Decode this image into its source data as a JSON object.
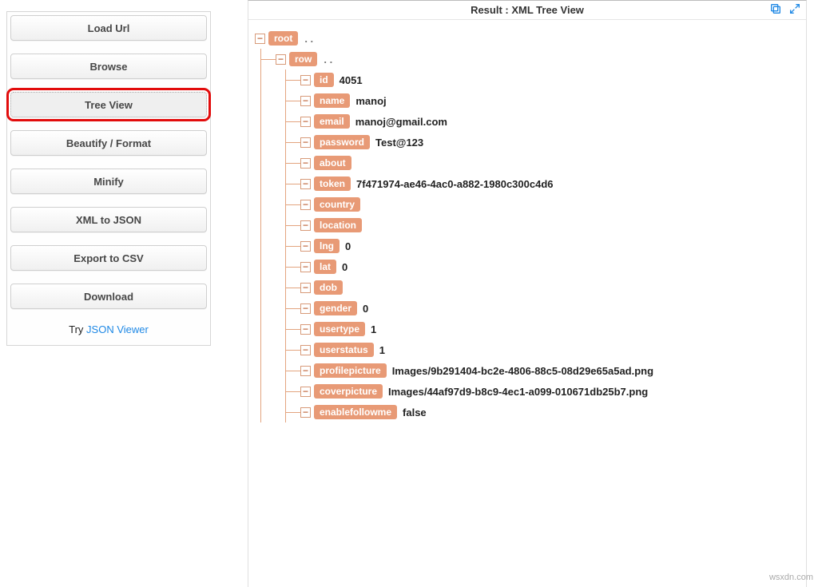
{
  "sidebar": {
    "buttons": [
      {
        "label": "Load Url",
        "selected": false
      },
      {
        "label": "Browse",
        "selected": false
      },
      {
        "label": "Tree View",
        "selected": true
      },
      {
        "label": "Beautify / Format",
        "selected": false
      },
      {
        "label": "Minify",
        "selected": false
      },
      {
        "label": "XML to JSON",
        "selected": false
      },
      {
        "label": "Export to CSV",
        "selected": false
      },
      {
        "label": "Download",
        "selected": false
      }
    ],
    "try_prefix": "Try ",
    "try_link": "JSON Viewer"
  },
  "result": {
    "title": "Result : XML Tree View"
  },
  "tree": {
    "root_label": "root",
    "root_dots": ". .",
    "row_label": "row",
    "row_dots": ". .",
    "leaves": [
      {
        "key": "id",
        "value": "4051"
      },
      {
        "key": "name",
        "value": "manoj"
      },
      {
        "key": "email",
        "value": "manoj@gmail.com"
      },
      {
        "key": "password",
        "value": "Test@123"
      },
      {
        "key": "about",
        "value": ""
      },
      {
        "key": "token",
        "value": "7f471974-ae46-4ac0-a882-1980c300c4d6"
      },
      {
        "key": "country",
        "value": ""
      },
      {
        "key": "location",
        "value": ""
      },
      {
        "key": "lng",
        "value": "0"
      },
      {
        "key": "lat",
        "value": "0"
      },
      {
        "key": "dob",
        "value": ""
      },
      {
        "key": "gender",
        "value": "0"
      },
      {
        "key": "usertype",
        "value": "1"
      },
      {
        "key": "userstatus",
        "value": "1"
      },
      {
        "key": "profilepicture",
        "value": "Images/9b291404-bc2e-4806-88c5-08d29e65a5ad.png"
      },
      {
        "key": "coverpicture",
        "value": "Images/44af97d9-b8c9-4ec1-a099-010671db25b7.png"
      },
      {
        "key": "enablefollowme",
        "value": "false"
      }
    ]
  },
  "watermark": "wsxdn.com"
}
